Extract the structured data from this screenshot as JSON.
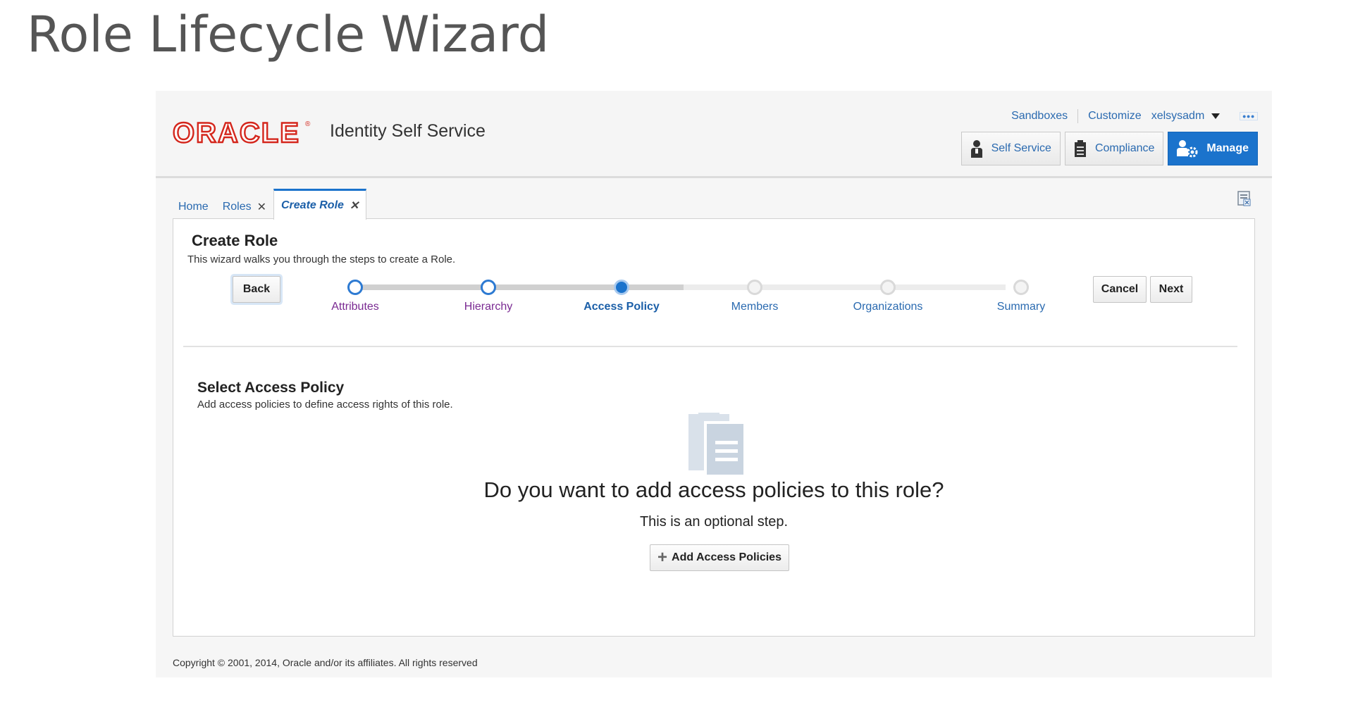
{
  "slide": {
    "title": "Role Lifecycle Wizard"
  },
  "header": {
    "logo_text": "ORACLE",
    "logo_reg": "®",
    "app_name": "Identity Self Service",
    "links": {
      "sandboxes": "Sandboxes",
      "customize": "Customize",
      "user": "xelsysadm",
      "more": "•••"
    },
    "nav": [
      {
        "label": "Self Service",
        "icon": "person-icon",
        "active": false
      },
      {
        "label": "Compliance",
        "icon": "clipboard-icon",
        "active": false
      },
      {
        "label": "Manage",
        "icon": "manage-gear-icon",
        "active": true
      }
    ]
  },
  "tabs": [
    {
      "label": "Home",
      "closable": false,
      "active": false
    },
    {
      "label": "Roles",
      "closable": true,
      "active": false
    },
    {
      "label": "Create Role",
      "closable": true,
      "active": true
    }
  ],
  "tab_close_glyph": "✕",
  "wizard": {
    "title": "Create Role",
    "description": "This wizard walks you through the steps to create a Role.",
    "back_label": "Back",
    "cancel_label": "Cancel",
    "next_label": "Next",
    "steps": [
      {
        "label": "Attributes",
        "state": "visited"
      },
      {
        "label": "Hierarchy",
        "state": "visited"
      },
      {
        "label": "Access Policy",
        "state": "current"
      },
      {
        "label": "Members",
        "state": "todo"
      },
      {
        "label": "Organizations",
        "state": "todo"
      },
      {
        "label": "Summary",
        "state": "todo"
      }
    ]
  },
  "section": {
    "title": "Select Access Policy",
    "description": "Add access policies to define access rights of this role.",
    "empty_question": "Do you want to add access policies to this role?",
    "empty_note": "This is an optional step.",
    "add_label": "Add Access Policies",
    "add_icon": "plus-icon"
  },
  "footer": {
    "copyright": "Copyright © 2001, 2014, Oracle and/or its affiliates. All rights reserved"
  },
  "colors": {
    "accent": "#1b73cc",
    "oracle_red": "#d4261c",
    "link": "#2a6ab0",
    "visited": "#7a2a92"
  }
}
